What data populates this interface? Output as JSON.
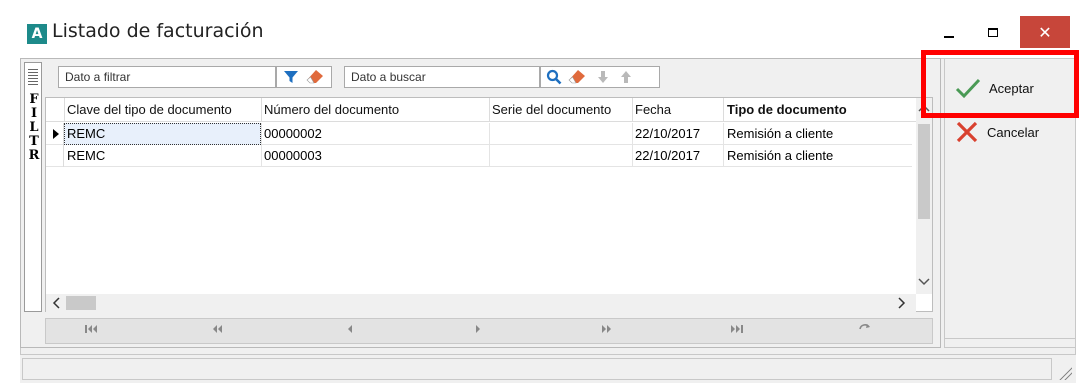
{
  "window": {
    "app_icon_letter": "A",
    "title": "Listado de facturación",
    "close_glyph": "✕"
  },
  "filter_panel": {
    "letters": [
      "F",
      "I",
      "L",
      "T",
      "R"
    ]
  },
  "toolbar": {
    "filter_placeholder": "Dato a filtrar",
    "search_placeholder": "Dato a buscar"
  },
  "grid": {
    "columns": [
      "Clave del tipo de documento",
      "Número del documento",
      "Serie del documento",
      "Fecha",
      "Tipo de documento"
    ],
    "rows": [
      {
        "clave": "REMC",
        "numero": "00000002",
        "serie": "",
        "fecha": "22/10/2017",
        "tipo": "Remisión a cliente"
      },
      {
        "clave": "REMC",
        "numero": "00000003",
        "serie": "",
        "fecha": "22/10/2017",
        "tipo": "Remisión a cliente"
      }
    ]
  },
  "actions": {
    "accept_label": "Aceptar",
    "cancel_label": "Cancelar"
  },
  "colors": {
    "accept_check": "#4a9a55",
    "cancel_x": "#d9412f",
    "highlight_box": "#ff0000",
    "close_button": "#c7463a"
  }
}
